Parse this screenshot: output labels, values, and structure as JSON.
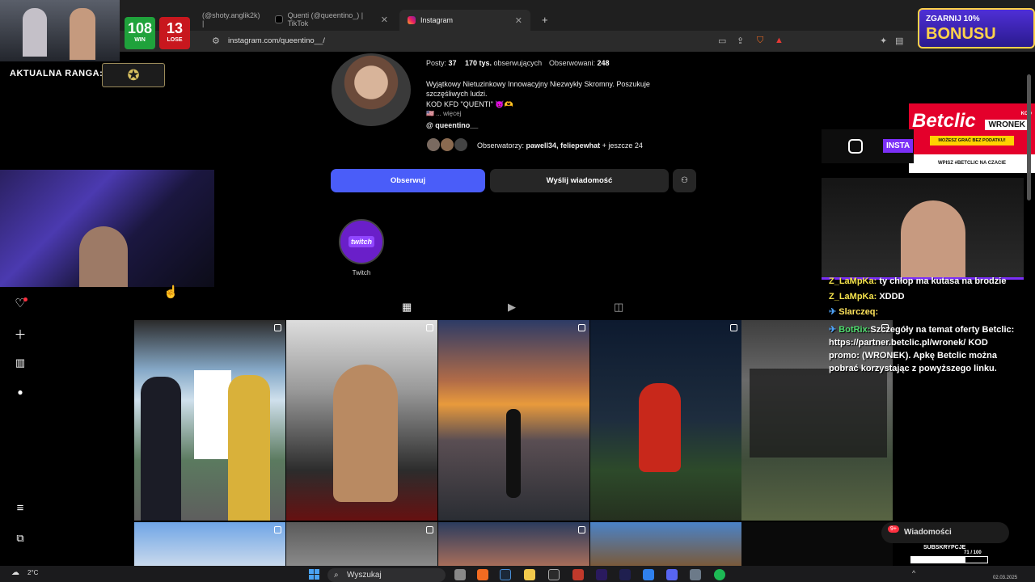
{
  "browser": {
    "tabs": [
      {
        "label": "(@shoty.anglik2k) |",
        "active": false
      },
      {
        "label": "Quenti (@queentino_) | TikTok",
        "active": false
      },
      {
        "label": "Instagram",
        "active": true
      }
    ],
    "new_tab": "+",
    "url": "instagram.com/queentino__/"
  },
  "profile": {
    "stats": {
      "posts_label": "Posty:",
      "posts": "37",
      "followers": "170 tys.",
      "followers_label": "obserwujących",
      "following_label": "Obserwowani:",
      "following": "248"
    },
    "bio": [
      "Wyjątkowy Nietuzinkowy Innowacyjny Niezwykły Skromny. Poszukuje",
      "szczęśliwych ludzi.",
      "KOD KFD \"QUENTI\" 😈🫶",
      "🇺🇸 ... więcej"
    ],
    "threads_handle": "queentino__",
    "followed_by_prefix": "Obserwatorzy:",
    "followed_by_names": "pawell34, feliepewhat",
    "followed_by_more": "+ jeszcze 24",
    "follow_button": "Obserwuj",
    "message_button": "Wyślij wiadomość",
    "highlight": {
      "badge": "twitch",
      "label": "Twitch"
    }
  },
  "stream_overlay": {
    "wins": "108",
    "wins_label": "WIN",
    "loses": "13",
    "loses_label": "LOSE",
    "rank_label": "AKTUALNA RANGA:",
    "promo": {
      "line1": "ZGARNIJ 10%",
      "line2": "BONUSU"
    },
    "betclic": {
      "logo": "Betclic",
      "kod": "KOD",
      "code": "WRONEK",
      "band": "MOŻESZ GRAĆ BEZ PODATKU!",
      "foot": "WPISZ #BETCLIC NA CZACIE"
    },
    "insta_label": "INSTA",
    "chat": [
      {
        "user": "Z_LaMpKa:",
        "text": "ty chłop ma kutasa na brodzie"
      },
      {
        "user": "Z_LaMpKa:",
        "text": "XDDD"
      },
      {
        "user": "Slarczeq:",
        "text": ""
      },
      {
        "user": "BotRix:",
        "text": "Szczegóły na temat oferty Betclic: https://partner.betclic.pl/wronek/ KOD promo: (WRONEK). Apkę Betclic można pobrać korzystając z powyższego linku."
      }
    ],
    "dm_label": "Wiadomości",
    "dm_badge": "9+",
    "subs_label": "SUBSKRYPCJE",
    "subs_value": "71 / 100",
    "subs_current": 71,
    "subs_goal": 100
  },
  "taskbar": {
    "weather_temp": "2°C",
    "search_placeholder": "Wyszukaj",
    "clock_date": "02.03.2025"
  }
}
